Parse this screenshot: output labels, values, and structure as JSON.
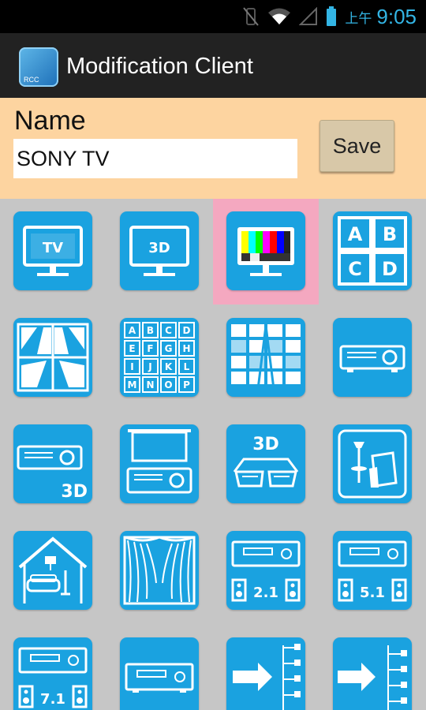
{
  "status_bar": {
    "ampm": "上午",
    "time": "9:05"
  },
  "app": {
    "title": "Modification Client",
    "icon_badge": "RCC"
  },
  "form": {
    "name_label": "Name",
    "name_value": "SONY TV",
    "save_label": "Save"
  },
  "icon_grid": {
    "selected_index": 2,
    "icons": [
      {
        "name": "tv-icon",
        "text": "TV"
      },
      {
        "name": "tv-3d-icon",
        "text": "3D"
      },
      {
        "name": "color-bars-tv-icon",
        "text": ""
      },
      {
        "name": "abcd-quad-icon",
        "letters": [
          "A",
          "B",
          "C",
          "D"
        ]
      },
      {
        "name": "road-windows-icon",
        "text": ""
      },
      {
        "name": "keyboard-grid-icon",
        "letters": [
          "A",
          "B",
          "C",
          "D",
          "E",
          "F",
          "G",
          "H",
          "I",
          "J",
          "K",
          "L",
          "M",
          "N",
          "O",
          "P"
        ]
      },
      {
        "name": "split-screen-grid-icon",
        "text": ""
      },
      {
        "name": "projector-icon",
        "text": ""
      },
      {
        "name": "projector-3d-icon",
        "text": "3D"
      },
      {
        "name": "projector-screen-icon",
        "text": ""
      },
      {
        "name": "3d-glasses-icon",
        "text": "3D"
      },
      {
        "name": "lounge-chair-lamp-icon",
        "text": ""
      },
      {
        "name": "living-room-icon",
        "text": ""
      },
      {
        "name": "theater-curtain-icon",
        "text": ""
      },
      {
        "name": "receiver-2-1-icon",
        "text": "2.1"
      },
      {
        "name": "receiver-5-1-icon",
        "text": "5.1"
      },
      {
        "name": "receiver-7-1-icon",
        "text": "7.1"
      },
      {
        "name": "receiver-icon",
        "text": ""
      },
      {
        "name": "arrow-switch-icon",
        "text": ""
      },
      {
        "name": "arrow-switch-alt-icon",
        "text": ""
      }
    ]
  },
  "colors": {
    "tile": "#1aa2e0",
    "selected": "#f4a8c0",
    "panel": "#fdd4a0",
    "accent": "#33b5e5"
  }
}
